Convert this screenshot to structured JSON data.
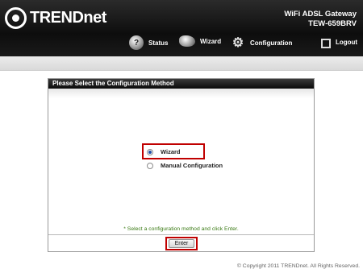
{
  "header": {
    "brand": "TRENDnet",
    "model_line1": "WiFi ADSL Gateway",
    "model_line2": "TEW-659BRV"
  },
  "nav": [
    {
      "label": "Status",
      "icon": "status-icon"
    },
    {
      "label": "Wizard",
      "icon": "wizard-icon"
    },
    {
      "label": "Configuration",
      "icon": "configuration-icon"
    },
    {
      "label": "Logout",
      "icon": "logout-icon"
    }
  ],
  "panel": {
    "title": "Please Select the Configuration Method",
    "options": [
      {
        "label": "Wizard",
        "checked": true
      },
      {
        "label": "Manual Configuration",
        "checked": false
      }
    ],
    "hint": "* Select a configuration method and click Enter.",
    "enter_label": "Enter"
  },
  "footer": {
    "copyright": "© Copyright 2011 TRENDnet. All Rights Reserved."
  },
  "colors": {
    "highlight": "#c00000",
    "hint": "#3a7a14",
    "header_bg": "#111111"
  }
}
